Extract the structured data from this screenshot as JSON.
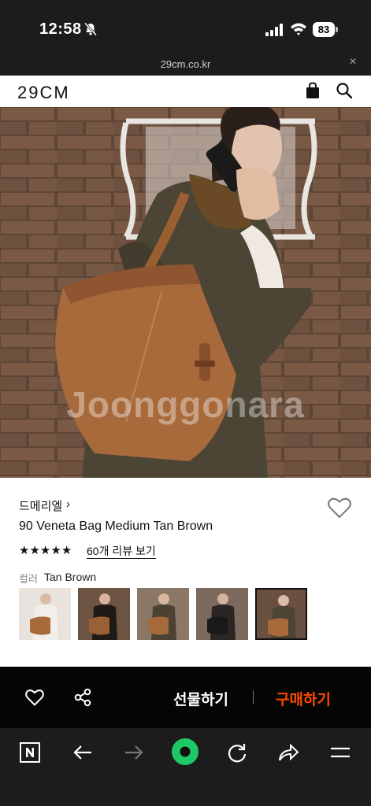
{
  "status_bar": {
    "time": "12:58",
    "battery": "83"
  },
  "url_bar": {
    "url": "29cm.co.kr",
    "close_glyph": "×"
  },
  "header": {
    "logo": "29CM",
    "icons": [
      "shopping-bag-icon",
      "search-icon"
    ]
  },
  "product_image": {
    "watermark": "Joonggonara"
  },
  "product": {
    "brand": "드메리엘",
    "brand_chevron": "›",
    "name": "90 Veneta Bag Medium Tan Brown",
    "rating_stars": 5,
    "review_link": "60개 리뷰 보기",
    "color_label": "컬러",
    "color_value": "Tan Brown",
    "variant_count": 5,
    "selected_variant": 5
  },
  "action_bar": {
    "gift_label": "선물하기",
    "buy_label": "구매하기",
    "buy_color": "#ff4800"
  },
  "browser_nav": {
    "icons": [
      "naver-icon",
      "back-arrow-icon",
      "forward-arrow-icon",
      "green-home-icon",
      "reload-icon",
      "share-arrow-icon",
      "menu-icon"
    ],
    "accent": "#1ec864"
  }
}
